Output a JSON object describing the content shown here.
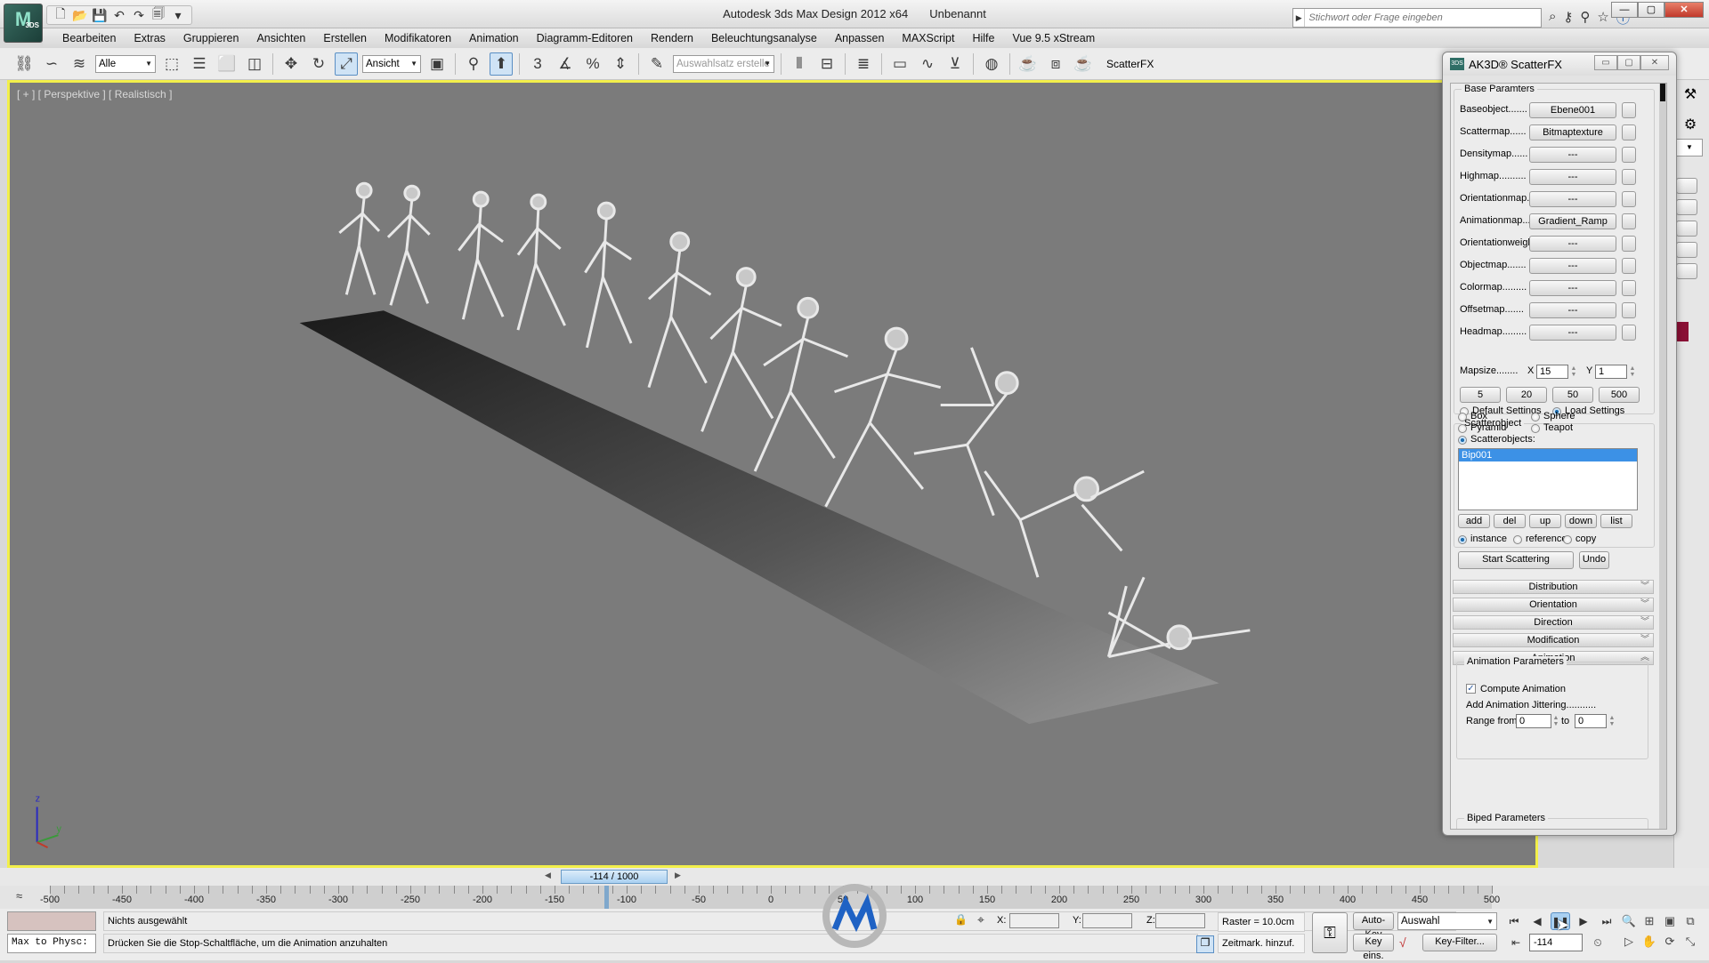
{
  "window": {
    "title": "Autodesk 3ds Max Design 2012 x64",
    "document": "Unbenannt",
    "app_badge": "3DS",
    "search_placeholder": "Stichwort oder Frage eingeben",
    "controls": {
      "minimize": "—",
      "maximize": "▢",
      "close": "✕"
    }
  },
  "menu": [
    "Bearbeiten",
    "Extras",
    "Gruppieren",
    "Ansichten",
    "Erstellen",
    "Modifikatoren",
    "Animation",
    "Diagramm-Editoren",
    "Rendern",
    "Beleuchtungsanalyse",
    "Anpassen",
    "MAXScript",
    "Hilfe",
    "Vue 9.5 xStream"
  ],
  "toolbar": {
    "filter_dropdown": "Alle",
    "coord_dropdown": "Ansicht",
    "selection_set_placeholder": "Auswahlsatz erstelle",
    "plugin_label": "ScatterFX"
  },
  "viewport": {
    "label": "[ + ] [ Perspektive ] [ Realistisch ]",
    "axes": {
      "z": "z",
      "y": "y",
      "x": "x"
    },
    "border_color": "#f2ef4a"
  },
  "dialog": {
    "title": "AK3D® ScatterFX",
    "base_group": "Base Paramters",
    "maps": [
      {
        "label": "Baseobject.......",
        "value": "Ebene001"
      },
      {
        "label": "Scattermap......",
        "value": "Bitmaptexture"
      },
      {
        "label": "Densitymap......",
        "value": "---"
      },
      {
        "label": "Highmap..........",
        "value": "---"
      },
      {
        "label": "Orientationmap..",
        "value": "---"
      },
      {
        "label": "Animationmap....",
        "value": "Gradient_Ramp"
      },
      {
        "label": "Orientationweigh",
        "value": "---"
      },
      {
        "label": "Objectmap.......",
        "value": "---"
      },
      {
        "label": "Colormap.........",
        "value": "---"
      },
      {
        "label": "Offsetmap.......",
        "value": "---"
      },
      {
        "label": "Headmap.........",
        "value": "---"
      }
    ],
    "mapsize_label": "Mapsize........",
    "mapsize_x_label": "X",
    "mapsize_x": "15",
    "mapsize_y_label": "Y",
    "mapsize_y": "1",
    "presets": [
      "5",
      "20",
      "50",
      "500"
    ],
    "settings_options": [
      {
        "label": "Default Settings",
        "selected": false
      },
      {
        "label": "Load Settings",
        "selected": true
      }
    ],
    "scatterobject_group": "Scatterobject",
    "object_types": [
      {
        "label": "Box",
        "selected": false
      },
      {
        "label": "Sphere",
        "selected": false
      },
      {
        "label": "Pyramid",
        "selected": false
      },
      {
        "label": "Teapot",
        "selected": false
      },
      {
        "label": "Scatterobjects:",
        "selected": true
      }
    ],
    "scatter_list": [
      "Bip001"
    ],
    "list_buttons": [
      "add",
      "del",
      "up",
      "down",
      "list"
    ],
    "copy_modes": [
      {
        "label": "instance",
        "selected": true
      },
      {
        "label": "reference",
        "selected": false
      },
      {
        "label": "copy",
        "selected": false
      }
    ],
    "start_button": "Start Scattering",
    "undo_button": "Undo",
    "rollouts": [
      {
        "label": "Distribution",
        "expanded": false
      },
      {
        "label": "Orientation",
        "expanded": false
      },
      {
        "label": "Direction",
        "expanded": false
      },
      {
        "label": "Modification",
        "expanded": false
      },
      {
        "label": "Animation",
        "expanded": true
      }
    ],
    "animation_group": "Animation Parameters",
    "compute_animation": {
      "label": "Compute Animation",
      "checked": true
    },
    "jitter_label": "Add Animation Jittering...........",
    "range_from_label": "Range from",
    "range_from": "0",
    "range_to_label": "to",
    "range_to": "0",
    "biped_group": "Biped Parameters"
  },
  "timeline": {
    "slider_label": "-114 / 1000",
    "current_frame": -114,
    "range": [
      -500,
      1000
    ],
    "visible_ticks": [
      "-500",
      "-450",
      "-400",
      "-350",
      "-300",
      "-250",
      "-200",
      "-150",
      "-100",
      "-50",
      "0",
      "50",
      "100",
      "150",
      "200",
      "250",
      "300",
      "350",
      "400",
      "450",
      "500"
    ]
  },
  "status": {
    "maxscript_field": "Max to Physc:",
    "selection_text": "Nichts ausgewählt",
    "prompt_text": "Drücken Sie die Stop-Schaltfläche, um die Animation anzuhalten",
    "x_label": "X:",
    "y_label": "Y:",
    "z_label": "Z:",
    "grid_text": "Raster = 10.0cm",
    "add_time_tag": "Zeitmark. hinzuf.",
    "auto_key": "Auto-Key",
    "set_key": "Key eins.",
    "key_mode_dropdown": "Auswahl",
    "key_filter": "Key-Filter...",
    "frame_field": "-114"
  }
}
